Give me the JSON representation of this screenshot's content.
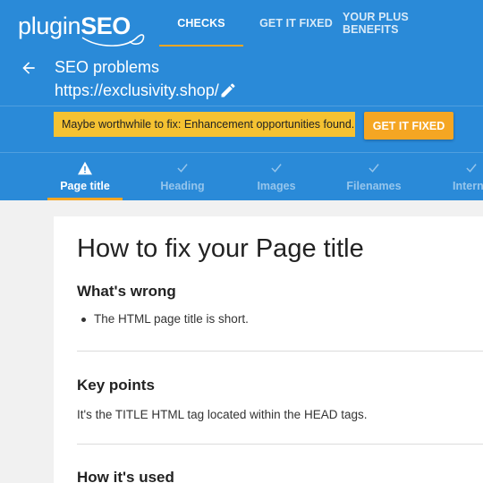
{
  "brand": {
    "logo_light": "plugin",
    "logo_bold": "SEO"
  },
  "nav": {
    "tabs": [
      {
        "label": "CHECKS",
        "active": true
      },
      {
        "label": "GET IT FIXED",
        "active": false
      },
      {
        "label": "YOUR PLUS BENEFITS",
        "active": false
      }
    ]
  },
  "header": {
    "title": "SEO problems",
    "url": "https://exclusivity.shop/",
    "notice": "Maybe worthwhile to fix: Enhancement opportunities found.",
    "fix_button": "GET IT FIXED"
  },
  "checks": {
    "tabs": [
      {
        "label": "Page title",
        "status": "warning",
        "icon": "warning-icon",
        "active": true
      },
      {
        "label": "Heading",
        "status": "ok",
        "icon": "checkmark-icon",
        "active": false
      },
      {
        "label": "Images",
        "status": "ok",
        "icon": "checkmark-icon",
        "active": false
      },
      {
        "label": "Filenames",
        "status": "ok",
        "icon": "checkmark-icon",
        "active": false
      },
      {
        "label": "Intern",
        "status": "ok",
        "icon": "checkmark-icon",
        "active": false
      }
    ]
  },
  "content": {
    "heading": "How to fix your Page title",
    "whats_wrong": {
      "title": "What's wrong",
      "items": [
        "The HTML page title is short."
      ]
    },
    "key_points": {
      "title": "Key points",
      "text": "It's the TITLE HTML tag located within the HEAD tags."
    },
    "how_used": {
      "title": "How it's used"
    }
  },
  "colors": {
    "header_blue": "#2a8ad8",
    "accent_orange": "#f5a623",
    "notice_yellow": "#f5c232"
  }
}
